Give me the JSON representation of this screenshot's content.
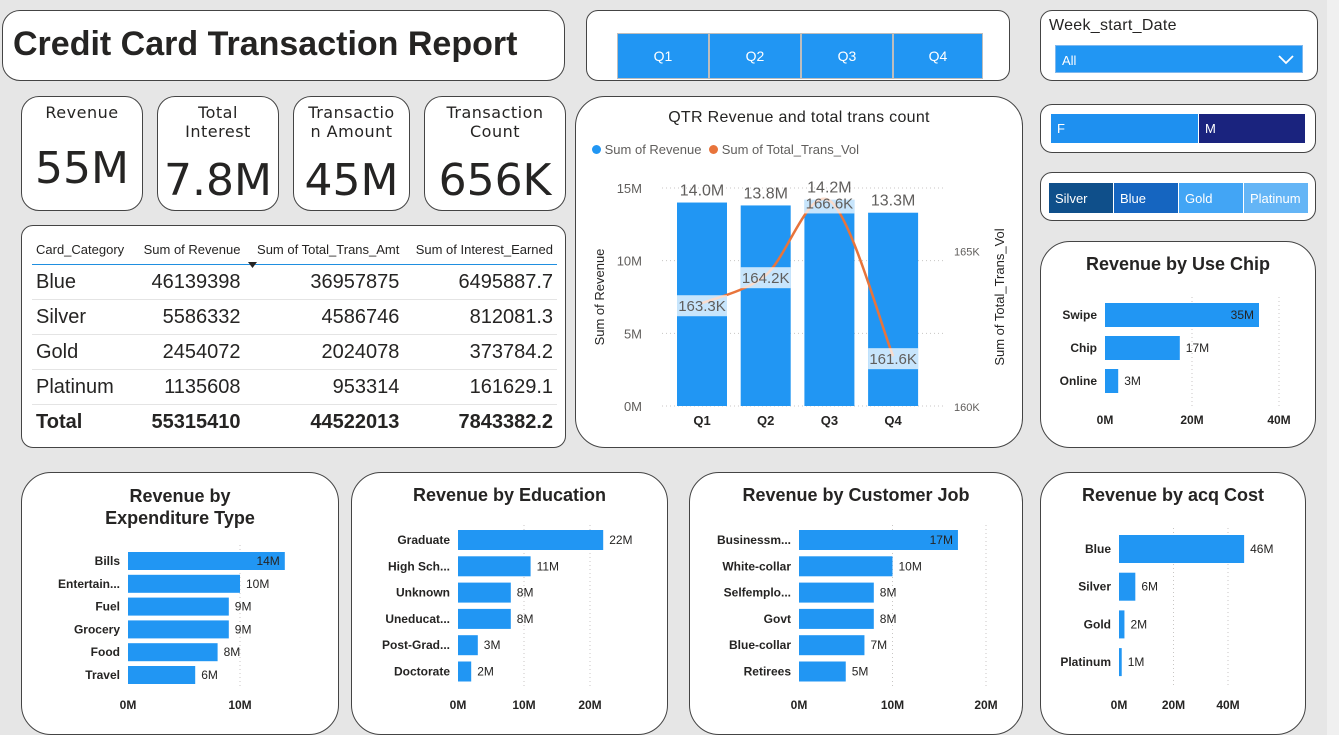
{
  "title": "Credit Card Transaction Report",
  "quarters": [
    "Q1",
    "Q2",
    "Q3",
    "Q4"
  ],
  "week_filter": {
    "label": "Week_start_Date",
    "value": "All"
  },
  "gender_slicer": [
    "F",
    "M"
  ],
  "category_slicer": [
    "Silver",
    "Blue",
    "Gold",
    "Platinum"
  ],
  "colors": {
    "bar": "#2196f3",
    "line": "#e8743b",
    "accent_dark": "#1a237e",
    "slicer_sel": "#0f4f8a"
  },
  "kpis": [
    {
      "label": "Revenue",
      "value": "55M"
    },
    {
      "label": "Total Interest",
      "value": "7.8M"
    },
    {
      "label": "Transactio n Amount",
      "value": "45M"
    },
    {
      "label": "Transaction Count",
      "value": "656K"
    }
  ],
  "matrix": {
    "headers": [
      "Card_Category",
      "Sum of Revenue",
      "Sum of Total_Trans_Amt",
      "Sum of Interest_Earned"
    ],
    "rows": [
      [
        "Blue",
        "46139398",
        "36957875",
        "6495887.7"
      ],
      [
        "Silver",
        "5586332",
        "4586746",
        "812081.3"
      ],
      [
        "Gold",
        "2454072",
        "2024078",
        "373784.2"
      ],
      [
        "Platinum",
        "1135608",
        "953314",
        "161629.1"
      ]
    ],
    "total": [
      "Total",
      "55315410",
      "44522013",
      "7843382.2"
    ]
  },
  "chart_data": [
    {
      "id": "qtr",
      "type": "bar",
      "title": "QTR Revenue and total trans count",
      "legend": [
        "Sum of Revenue",
        "Sum of Total_Trans_Vol"
      ],
      "categories": [
        "Q1",
        "Q2",
        "Q3",
        "Q4"
      ],
      "series": [
        {
          "name": "Sum of Revenue",
          "type": "bar",
          "values": [
            14.0,
            13.8,
            14.2,
            13.3
          ],
          "labels": [
            "14.0M",
            "13.8M",
            "14.2M",
            "13.3M"
          ]
        },
        {
          "name": "Sum of Total_Trans_Vol",
          "type": "line",
          "values": [
            163.3,
            164.2,
            166.6,
            161.6
          ],
          "labels": [
            "163.3K",
            "164.2K",
            "166.6K",
            "161.6K"
          ]
        }
      ],
      "ylabel": "Sum of Revenue",
      "y2label": "Sum of Total_Trans_Vol",
      "ylim": [
        0,
        15
      ],
      "yticks": [
        "0M",
        "5M",
        "10M",
        "15M"
      ],
      "y2lim": [
        160,
        167
      ],
      "y2ticks": [
        "160K",
        "165K"
      ]
    },
    {
      "id": "chip",
      "type": "bar",
      "title": "Revenue by Use Chip",
      "categories": [
        "Swipe",
        "Chip",
        "Online"
      ],
      "values": [
        35,
        17,
        3
      ],
      "labels": [
        "35M",
        "17M",
        "3M"
      ],
      "xlim": [
        0,
        45
      ],
      "xticks": [
        "0M",
        "20M",
        "40M"
      ]
    },
    {
      "id": "exp",
      "type": "bar",
      "title": "Revenue by Expenditure Type",
      "categories": [
        "Bills",
        "Entertain...",
        "Fuel",
        "Grocery",
        "Food",
        "Travel"
      ],
      "values": [
        14,
        10,
        9,
        9,
        8,
        6
      ],
      "labels": [
        "14M",
        "10M",
        "9M",
        "9M",
        "8M",
        "6M"
      ],
      "xlim": [
        0,
        15
      ],
      "xticks": [
        "0M",
        "10M"
      ]
    },
    {
      "id": "edu",
      "type": "bar",
      "title": "Revenue by Education",
      "categories": [
        "Graduate",
        "High Sch...",
        "Unknown",
        "Uneducat...",
        "Post-Grad...",
        "Doctorate"
      ],
      "values": [
        22,
        11,
        8,
        8,
        3,
        2
      ],
      "labels": [
        "22M",
        "11M",
        "8M",
        "8M",
        "3M",
        "2M"
      ],
      "xlim": [
        0,
        25
      ],
      "xticks": [
        "0M",
        "10M",
        "20M"
      ]
    },
    {
      "id": "job",
      "type": "bar",
      "title": "Revenue by Customer Job",
      "categories": [
        "Businessm...",
        "White-collar",
        "Selfemplo...",
        "Govt",
        "Blue-collar",
        "Retirees"
      ],
      "values": [
        17,
        10,
        8,
        8,
        7,
        5
      ],
      "labels": [
        "17M",
        "10M",
        "8M",
        "8M",
        "7M",
        "5M"
      ],
      "xlim": [
        0,
        20
      ],
      "xticks": [
        "0M",
        "10M",
        "20M"
      ]
    },
    {
      "id": "acq",
      "type": "bar",
      "title": "Revenue by acq Cost",
      "categories": [
        "Blue",
        "Silver",
        "Gold",
        "Platinum"
      ],
      "values": [
        46,
        6,
        2,
        1
      ],
      "labels": [
        "46M",
        "6M",
        "2M",
        "1M"
      ],
      "xlim": [
        0,
        50
      ],
      "xticks": [
        "0M",
        "20M",
        "40M"
      ]
    }
  ]
}
